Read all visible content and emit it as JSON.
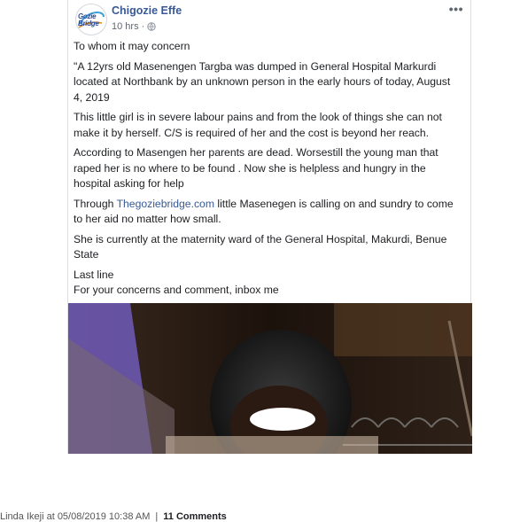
{
  "post": {
    "author": "Chigozie Effe",
    "time": "10 hrs",
    "more_label": "•••",
    "avatar_logo": "Gozie Bridge",
    "paragraphs": {
      "p1": "To whom it may concern",
      "p2": "\"A 12yrs old Masenengen Targba was dumped in General Hospital Markurdi located at Northbank by an unknown person in the early hours of today, August 4, 2019",
      "p3": "This little girl is in severe labour pains and from the look of things she can not make it by herself. C/S is required of her and the cost is beyond her reach.",
      "p4": "According to Masengen her parents are dead. Worsestill the young man that raped her is no where to be found . Now she is helpless and hungry in the hospital asking for help",
      "p5_prefix": "Through ",
      "p5_link": "Thegoziebridge.com",
      "p5_suffix": " little Masenegen is calling on and sundry to come to her aid no matter how small.",
      "p6": "She is currently at the maternity ward of the General Hospital, Makurdi, Benue State",
      "p7": "Last line",
      "p8": "For your concerns and comment, inbox me"
    }
  },
  "footer": {
    "posted_by": "Linda Ikeji at 05/08/2019 10:38 AM",
    "separator": "|",
    "comments": "11 Comments"
  },
  "colors": {
    "link": "#385898",
    "meta": "#616770"
  },
  "icons": [
    "globe-icon",
    "more-options-icon"
  ]
}
